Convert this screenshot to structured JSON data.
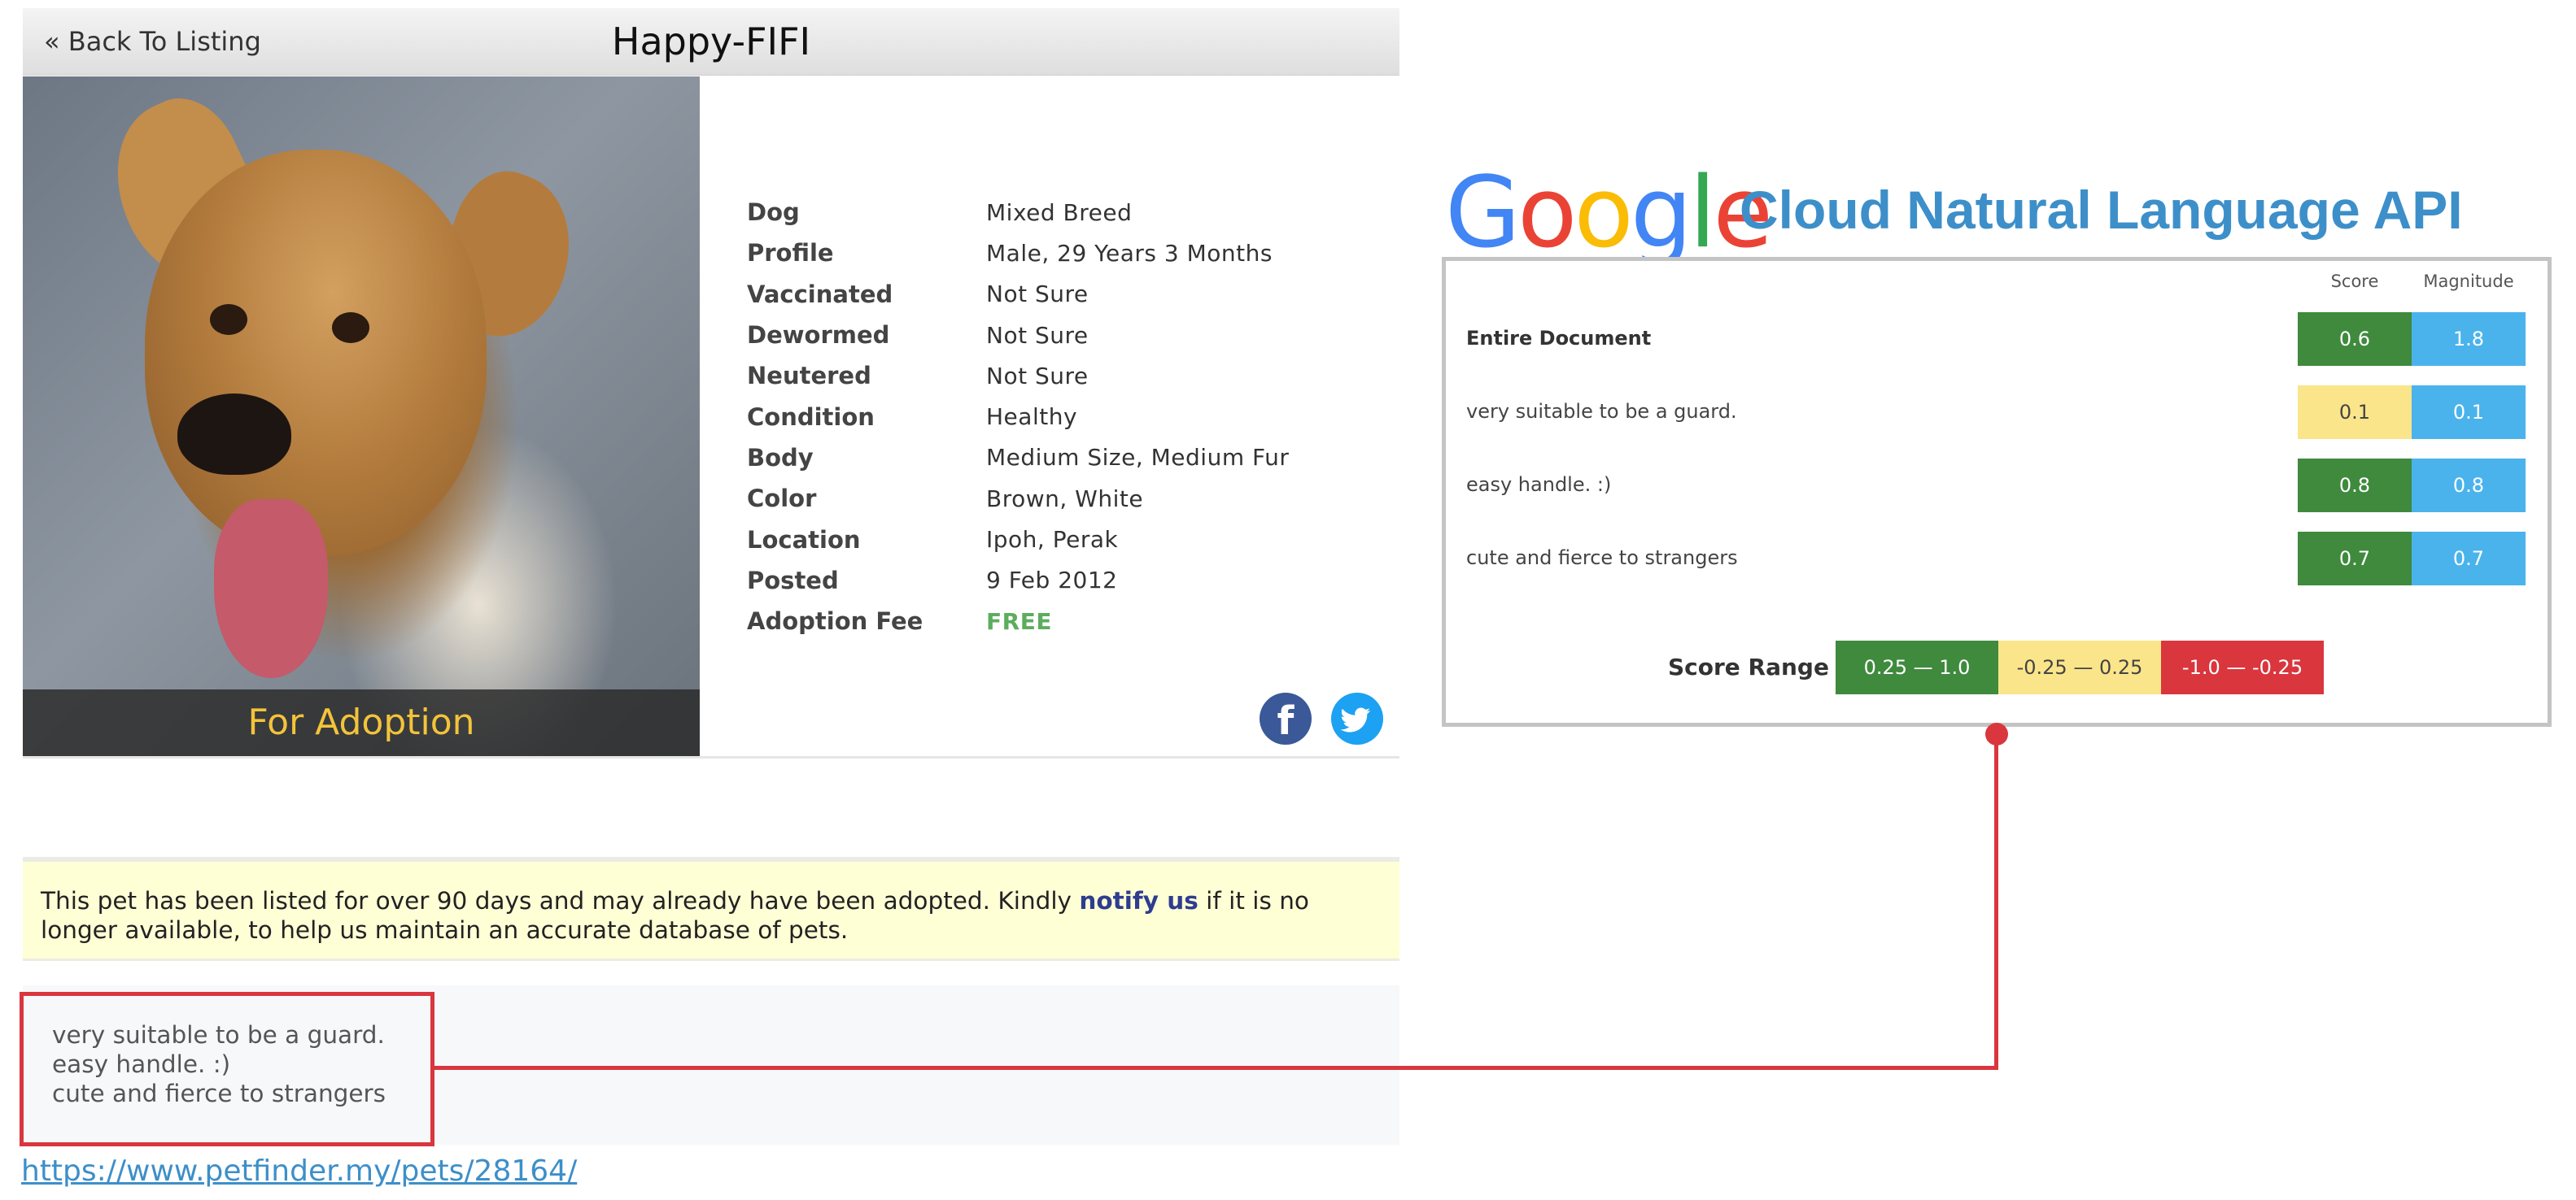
{
  "listing": {
    "back_label": "« Back To Listing",
    "title": "Happy-FIFI",
    "photo_banner": "For Adoption",
    "details": [
      {
        "label": "Dog",
        "value": "Mixed Breed"
      },
      {
        "label": "Profile",
        "value": "Male, 29 Years 3 Months"
      },
      {
        "label": "Vaccinated",
        "value": "Not Sure"
      },
      {
        "label": "Dewormed",
        "value": "Not Sure"
      },
      {
        "label": "Neutered",
        "value": "Not Sure"
      },
      {
        "label": "Condition",
        "value": "Healthy"
      },
      {
        "label": "Body",
        "value": "Medium Size, Medium Fur"
      },
      {
        "label": "Color",
        "value": "Brown, White"
      },
      {
        "label": "Location",
        "value": "Ipoh, Perak"
      },
      {
        "label": "Posted",
        "value": "9 Feb 2012"
      },
      {
        "label": "Adoption Fee",
        "value": "FREE"
      }
    ],
    "social": {
      "facebook_glyph": "f",
      "twitter_glyph": "t"
    },
    "notice": {
      "before": "This pet has been listed for over 90 days and may already have been adopted. Kindly ",
      "link": "notify us",
      "after": " if it is no longer available, to help us maintain an accurate database of pets."
    },
    "description": [
      "very suitable to be a guard.",
      "easy handle. :)",
      "cute and fierce to strangers"
    ],
    "url": "https://www.petfinder.my/pets/28164/"
  },
  "nl_api": {
    "logo_text": "Google",
    "title": "Cloud Natural Language API",
    "col_score": "Score",
    "col_magnitude": "Magnitude",
    "rows": [
      {
        "label": "Entire Document",
        "score": "0.6",
        "magnitude": "1.8",
        "sentiment": "positive"
      },
      {
        "label": "very suitable to be a guard.",
        "score": "0.1",
        "magnitude": "0.1",
        "sentiment": "neutral"
      },
      {
        "label": "easy handle. :)",
        "score": "0.8",
        "magnitude": "0.8",
        "sentiment": "positive"
      },
      {
        "label": "cute and fierce to strangers",
        "score": "0.7",
        "magnitude": "0.7",
        "sentiment": "positive"
      }
    ],
    "range_label": "Score Range",
    "ranges": [
      "0.25 — 1.0",
      "-0.25 — 0.25",
      "-1.0 — -0.25"
    ],
    "colors": {
      "positive": "#3f8a3d",
      "neutral": "#fbe58a",
      "negative": "#d9363e",
      "magnitude": "#4ab3ec"
    }
  }
}
